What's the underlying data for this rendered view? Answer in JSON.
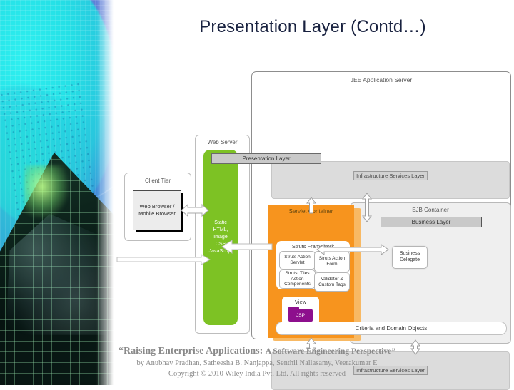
{
  "slide": {
    "title": "Presentation Layer (Contd…)"
  },
  "colors": {
    "title": "#18213f",
    "servlet_container": "#f7941e",
    "web_content": "#7dc224",
    "jsp_folder": "#8d0f8d",
    "infrastructure": "#dcdcdc",
    "footer_text": "#8a8a8a"
  },
  "diagram": {
    "jee_server": {
      "label": "JEE Application Server"
    },
    "infrastructure_top": {
      "label": "Infrastructure Services Layer"
    },
    "infrastructure_bottom": {
      "label": "Infrastructure Services Layer"
    },
    "ejb_container": {
      "label": "EJB Container",
      "business_layer": "Business Layer",
      "business_delegate": "Business\nDelegate",
      "business_delegate_line1": "Business",
      "business_delegate_line2": "Delegate"
    },
    "servlet_container": {
      "label": "Servlet Container",
      "presentation_layer": "Presentation Layer",
      "struts_framework": {
        "label": "Struts Framework",
        "boxes": [
          "Struts Action Servlet",
          "Struts Action Form",
          "Struts, Tiles Action Components",
          "Validator & Custom Tags"
        ]
      },
      "view": {
        "label": "View",
        "folder_label": "JSP"
      }
    },
    "criteria_bar": {
      "label": "Criteria and Domain Objects"
    },
    "web_server": {
      "label": "Web Server",
      "content_lines": "Static HTML, Image CSS JavaScript",
      "content_l1": "Static",
      "content_l2": "HTML,",
      "content_l3": "Image",
      "content_l4": "CSS",
      "content_l5": "JavaScript"
    },
    "client_tier": {
      "label": "Client Tier",
      "browser_l1": "Web Browser /",
      "browser_l2": "Mobile Browser"
    }
  },
  "footer": {
    "line1_quote_open": "“Raising Enterprise Applications: ",
    "line1_sub": "A Software Engineering Perspective”",
    "line2": "by Anubhav Pradhan, Satheesha B. Nanjappa, Senthil Nallasamy, Veerakumar E",
    "line3": "Copyright © 2010 Wiley India Pvt. Ltd.  All rights reserved"
  }
}
